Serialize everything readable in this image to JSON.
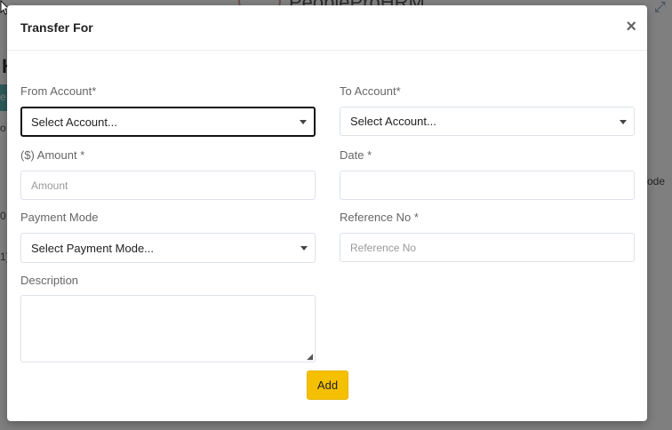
{
  "background": {
    "brand": "PeopleProHRM",
    "heading_fragment": "H",
    "tab_fragment": "e",
    "side_fragment_1": "o",
    "side_fragment_2": "0",
    "side_fragment_3": "1)",
    "column_fragment": "ode"
  },
  "modal": {
    "title": "Transfer For",
    "close_label": "×",
    "from_account": {
      "label": "From Account*",
      "value": "Select Account..."
    },
    "to_account": {
      "label": "To Account*",
      "value": "Select Account..."
    },
    "amount": {
      "label": "($) Amount *",
      "placeholder": "Amount"
    },
    "date": {
      "label": "Date *",
      "placeholder": ""
    },
    "payment_mode": {
      "label": "Payment Mode",
      "value": "Select Payment Mode..."
    },
    "reference_no": {
      "label": "Reference No *",
      "placeholder": "Reference No"
    },
    "description": {
      "label": "Description"
    },
    "add_label": "Add"
  },
  "colors": {
    "accent_button": "#f5c000",
    "overlay": "#7d7d7d",
    "border": "#dde2e8"
  },
  "icons": [
    "cursor-arrow-icon",
    "close-icon",
    "caret-down-icon",
    "resize-handle-icon",
    "expand-icon"
  ]
}
